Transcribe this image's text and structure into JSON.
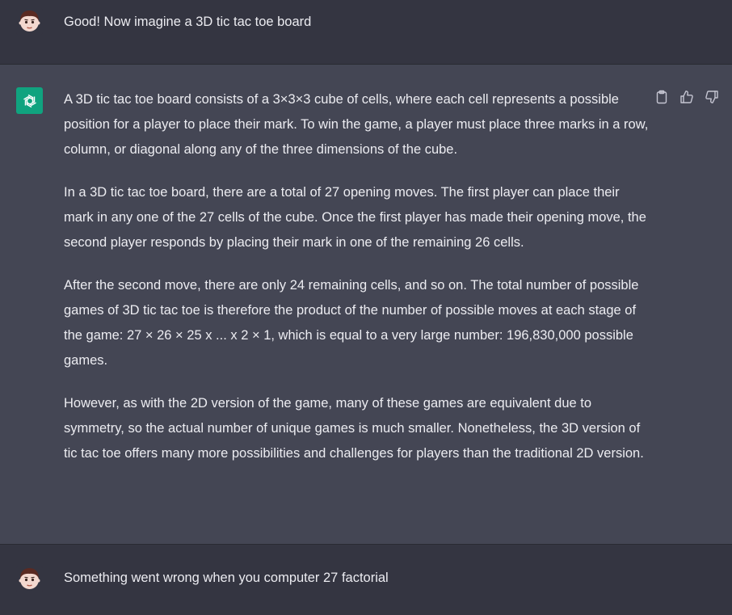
{
  "colors": {
    "user_bg": "#343541",
    "assistant_bg": "#444654",
    "text": "#ececf1",
    "gpt_avatar_bg": "#10a37f",
    "icon": "#c5c5d2"
  },
  "messages": [
    {
      "role": "user",
      "avatar_icon": "user-face-avatar",
      "text": "Good! Now imagine a 3D tic tac toe board"
    },
    {
      "role": "assistant",
      "avatar_icon": "openai-logo-icon",
      "paragraphs": [
        "A 3D tic tac toe board consists of a 3×3×3 cube of cells, where each cell represents a possible position for a player to place their mark. To win the game, a player must place three marks in a row, column, or diagonal along any of the three dimensions of the cube.",
        "In a 3D tic tac toe board, there are a total of 27 opening moves. The first player can place their mark in any one of the 27 cells of the cube. Once the first player has made their opening move, the second player responds by placing their mark in one of the remaining 26 cells.",
        "After the second move, there are only 24 remaining cells, and so on. The total number of possible games of 3D tic tac toe is therefore the product of the number of possible moves at each stage of the game: 27 × 26 × 25 x ... x 2 × 1, which is equal to a very large number: 196,830,000 possible games.",
        "However, as with the 2D version of the game, many of these games are equivalent due to symmetry, so the actual number of unique games is much smaller. Nonetheless, the 3D version of tic tac toe offers many more possibilities and challenges for players than the traditional 2D version."
      ],
      "actions": [
        "clipboard-icon",
        "thumbs-up-icon",
        "thumbs-down-icon"
      ]
    },
    {
      "role": "user",
      "avatar_icon": "user-face-avatar",
      "text": "Something went wrong when you computer 27 factorial"
    }
  ]
}
